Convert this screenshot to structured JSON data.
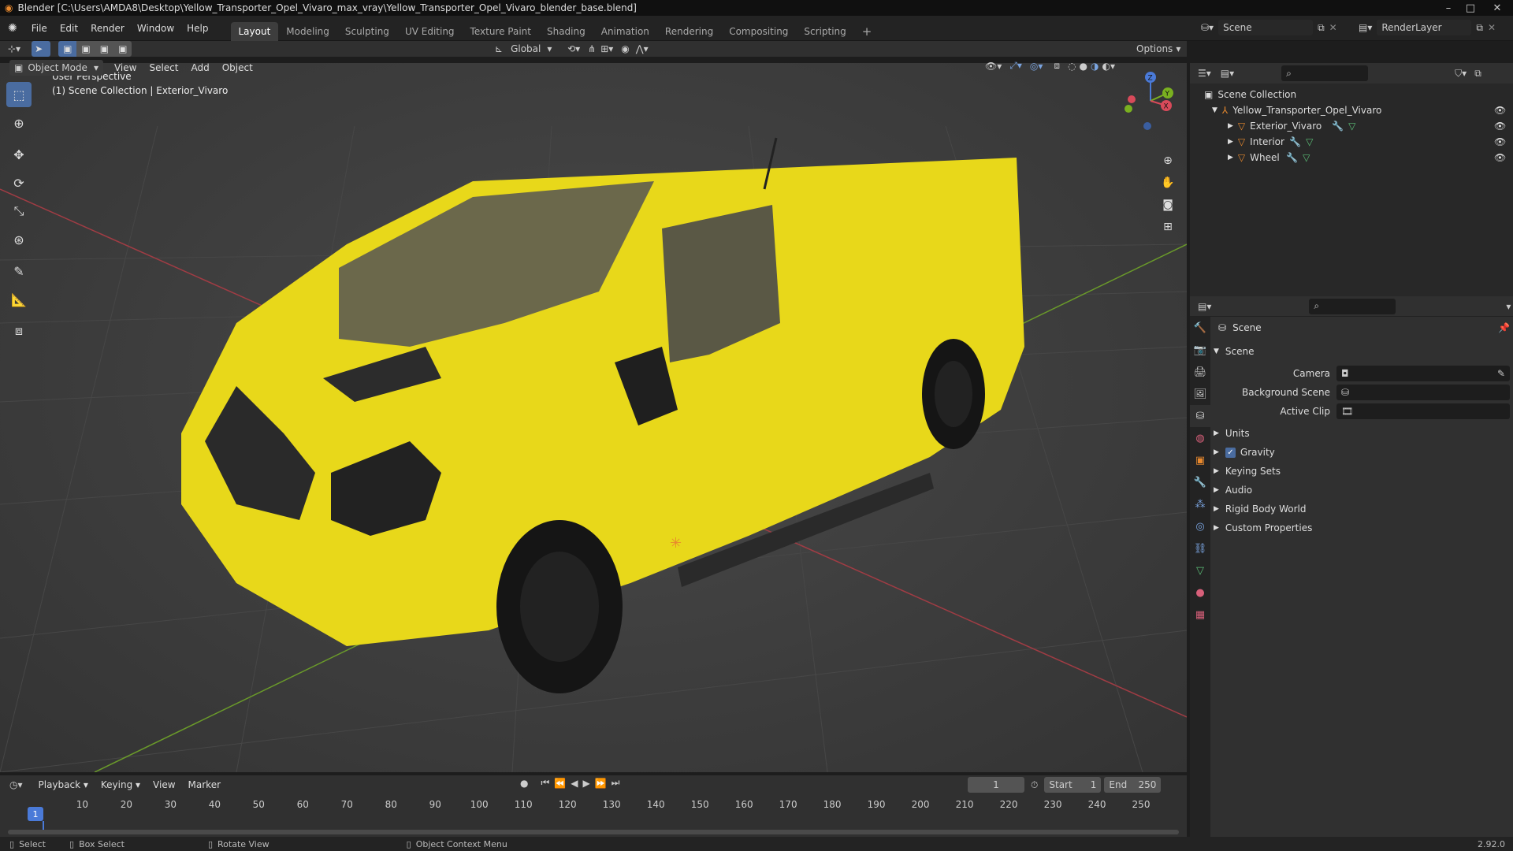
{
  "window": {
    "title": "Blender [C:\\Users\\AMDA8\\Desktop\\Yellow_Transporter_Opel_Vivaro_max_vray\\Yellow_Transporter_Opel_Vivaro_blender_base.blend]",
    "minimize": "–",
    "maximize": "□",
    "close": "✕"
  },
  "menu": {
    "file": "File",
    "edit": "Edit",
    "render": "Render",
    "window": "Window",
    "help": "Help"
  },
  "workspaces": [
    "Layout",
    "Modeling",
    "Sculpting",
    "UV Editing",
    "Texture Paint",
    "Shading",
    "Animation",
    "Rendering",
    "Compositing",
    "Scripting"
  ],
  "workspace_add": "+",
  "scene_selector": {
    "label": "Scene"
  },
  "layer_selector": {
    "label": "RenderLayer"
  },
  "viewport_header": {
    "transform": "Global",
    "options": "Options",
    "mode": "Object Mode",
    "view": "View",
    "select": "Select",
    "add": "Add",
    "object": "Object"
  },
  "viewport": {
    "perspective": "User Perspective",
    "collection_info": "(1) Scene Collection | Exterior_Vivaro",
    "axis_x": "X",
    "axis_y": "Y",
    "axis_z": "Z"
  },
  "outliner": {
    "root": "Scene Collection",
    "items": [
      {
        "name": "Yellow_Transporter_Opel_Vivaro"
      },
      {
        "name": "Exterior_Vivaro"
      },
      {
        "name": "Interior"
      },
      {
        "name": "Wheel"
      }
    ]
  },
  "properties": {
    "context": "Scene",
    "panel": "Scene",
    "camera_label": "Camera",
    "bg_scene_label": "Background Scene",
    "active_clip_label": "Active Clip",
    "sections": [
      "Units",
      "Gravity",
      "Keying Sets",
      "Audio",
      "Rigid Body World",
      "Custom Properties"
    ]
  },
  "timeline": {
    "playback": "Playback",
    "keying": "Keying",
    "view": "View",
    "marker": "Marker",
    "current_frame": "1",
    "start_label": "Start",
    "start": "1",
    "end_label": "End",
    "end": "250",
    "ticks": [
      "1",
      "10",
      "20",
      "30",
      "40",
      "50",
      "60",
      "70",
      "80",
      "90",
      "100",
      "110",
      "120",
      "130",
      "140",
      "150",
      "160",
      "170",
      "180",
      "190",
      "200",
      "210",
      "220",
      "230",
      "240",
      "250"
    ]
  },
  "statusbar": {
    "select": "Select",
    "box_select": "Box Select",
    "rotate": "Rotate View",
    "context_menu": "Object Context Menu",
    "version": "2.92.0"
  },
  "colors": {
    "accent": "#4a6ca0",
    "object_orange": "#e8892e",
    "van_yellow": "#f0e020"
  }
}
